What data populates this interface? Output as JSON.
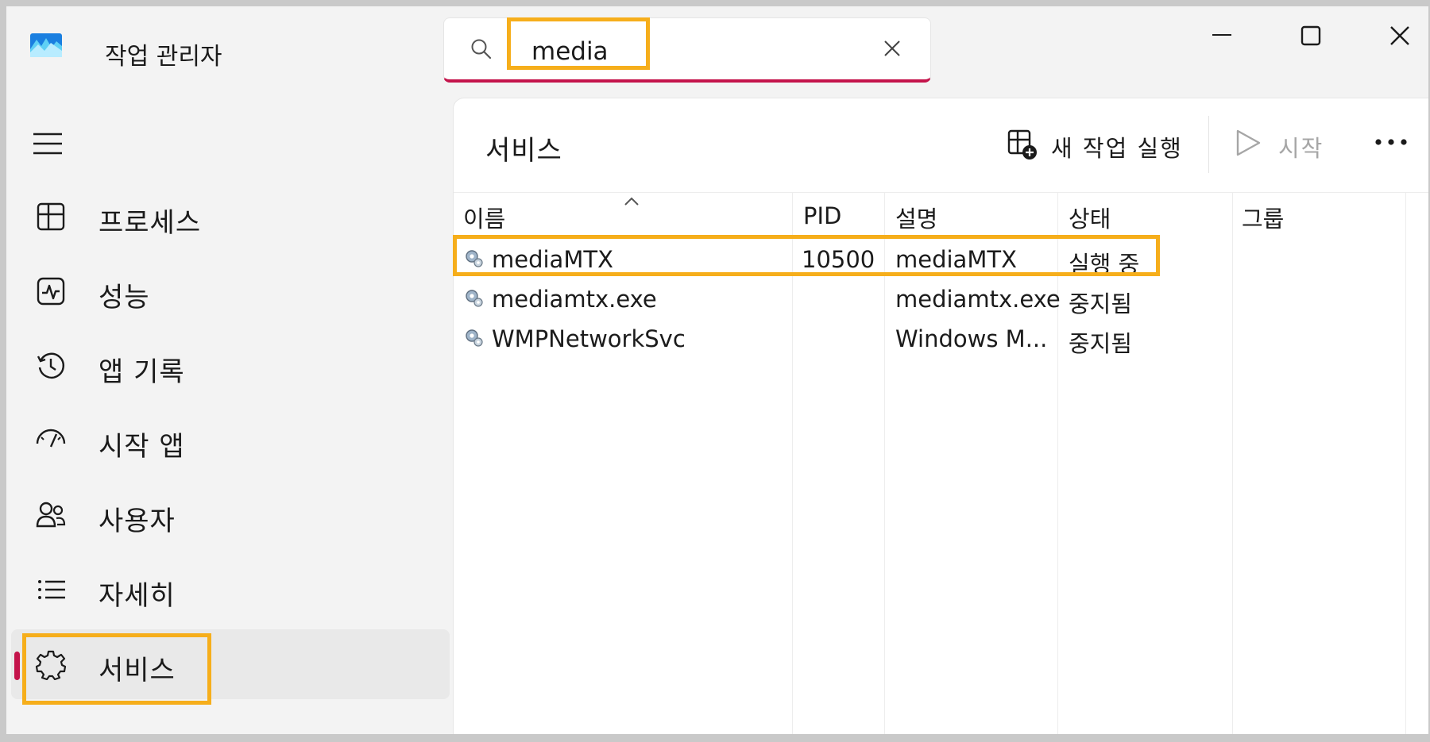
{
  "app": {
    "title": "작업 관리자"
  },
  "search": {
    "value": "media",
    "placeholder": ""
  },
  "sidebar": {
    "items": [
      {
        "label": "프로세스",
        "icon": "processes-icon"
      },
      {
        "label": "성능",
        "icon": "performance-icon"
      },
      {
        "label": "앱 기록",
        "icon": "app-history-icon"
      },
      {
        "label": "시작 앱",
        "icon": "startup-apps-icon"
      },
      {
        "label": "사용자",
        "icon": "users-icon"
      },
      {
        "label": "자세히",
        "icon": "details-icon"
      },
      {
        "label": "서비스",
        "icon": "services-icon",
        "active": true
      }
    ]
  },
  "page": {
    "title": "서비스",
    "commands": {
      "new_task": "새 작업 실행",
      "start": "시작"
    }
  },
  "table": {
    "columns": [
      "이름",
      "PID",
      "설명",
      "상태",
      "그룹"
    ],
    "rows": [
      {
        "name": "mediaMTX",
        "pid": "10500",
        "description": "mediaMTX",
        "status": "실행 중",
        "group": ""
      },
      {
        "name": "mediamtx.exe",
        "pid": "",
        "description": "mediamtx.exe",
        "status": "중지됨",
        "group": ""
      },
      {
        "name": "WMPNetworkSvc",
        "pid": "",
        "description": "Windows M...",
        "status": "중지됨",
        "group": ""
      }
    ]
  },
  "colors": {
    "accent": "#c4144b",
    "highlight": "#f6ae1b",
    "sidebar_bg": "#f3f3f3",
    "disabled_text": "#a6a6a6"
  }
}
